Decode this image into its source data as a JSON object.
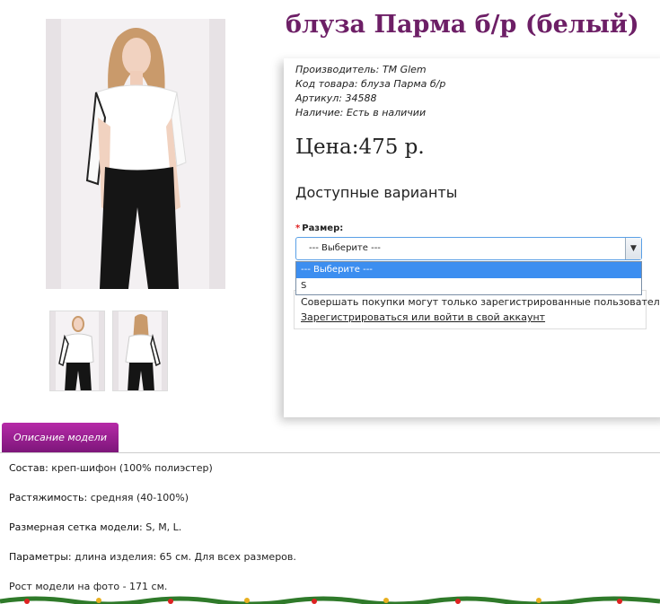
{
  "product": {
    "title": "блуза Парма б/р (белый)",
    "price": "Цена:475 р."
  },
  "meta": [
    {
      "key": "Производитель:",
      "value": "TM Glem"
    },
    {
      "key": "Код товара:",
      "value": "блуза Парма б/р"
    },
    {
      "key": "Артикул:",
      "value": "34588"
    },
    {
      "key": "Наличие:",
      "value": "Есть в наличии"
    }
  ],
  "variants": {
    "heading": "Доступные варианты",
    "size_label": "Размер:",
    "selected": "--- Выберите ---",
    "options": [
      "--- Выберите ---",
      "S"
    ]
  },
  "notice": {
    "message": "Совершать покупки могут только зарегистрированные пользователи!",
    "link": "Зарегистрироваться или войти в свой аккаунт"
  },
  "tabs": {
    "description": "Описание модели"
  },
  "description": [
    {
      "label": "Состав:",
      "value": "креп-шифон (100% полиэстер)"
    },
    {
      "label": "Растяжимость:",
      "value": "средняя (40-100%)"
    },
    {
      "label": "Размерная сетка модели:",
      "value": "S, M, L."
    },
    {
      "label": "Параметры:",
      "value": "длина изделия: 65 см. Для всех размеров."
    },
    {
      "label": "",
      "value": "Рост модели на фото - 171 см."
    }
  ],
  "colors": {
    "title": "#6d1f66",
    "tab": "#a0239b",
    "select_highlight": "#3c8ef0"
  }
}
